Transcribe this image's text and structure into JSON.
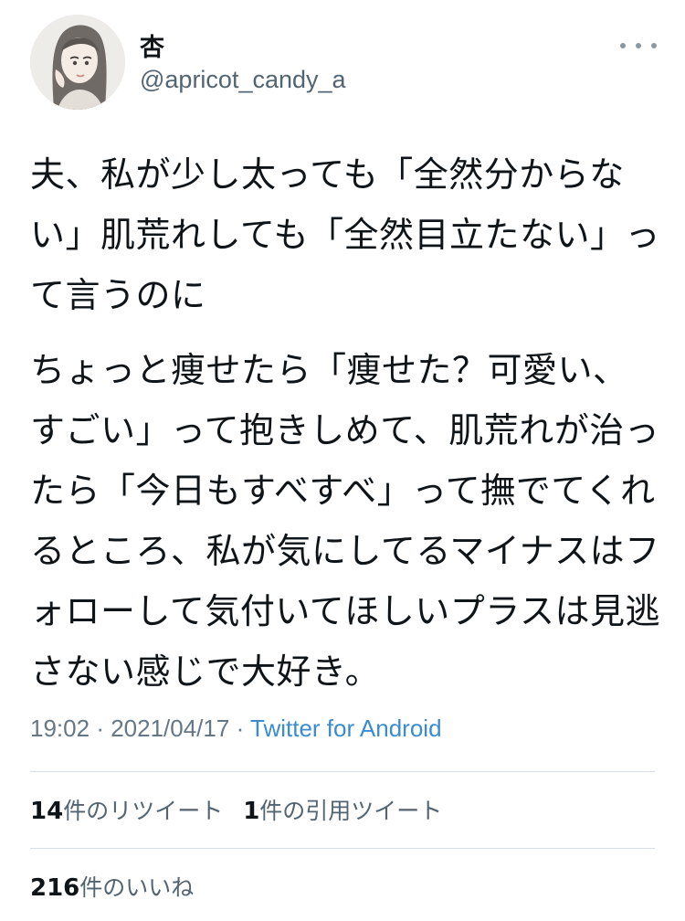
{
  "author": {
    "name": "杏",
    "handle": "@apricot_candy_a"
  },
  "tweet": {
    "paragraph1": "夫、私が少し太っても「全然分からない」肌荒れしても「全然目立たない」って言うのに",
    "paragraph2": "ちょっと痩せたら「痩せた？可愛い、すごい」って抱きしめて、肌荒れが治ったら「今日もすべすべ」って撫でてくれるところ、私が気にしてるマイナスはフォローして気付いてほしいプラスは見逃さない感じで大好き。",
    "time": "19:02",
    "date": "2021/04/17",
    "source": "Twitter for Android",
    "separator": "·"
  },
  "stats": {
    "retweets_count": "14",
    "retweets_label": "件のリツイート",
    "quotes_count": "1",
    "quotes_label": "件の引用ツイート",
    "likes_count": "216",
    "likes_label": "件のいいね"
  },
  "colors": {
    "secondary_text": "#657786",
    "link": "#3a8bd0",
    "divider": "#d8dee3"
  },
  "icons": {
    "more": "more-horizontal-icon"
  }
}
